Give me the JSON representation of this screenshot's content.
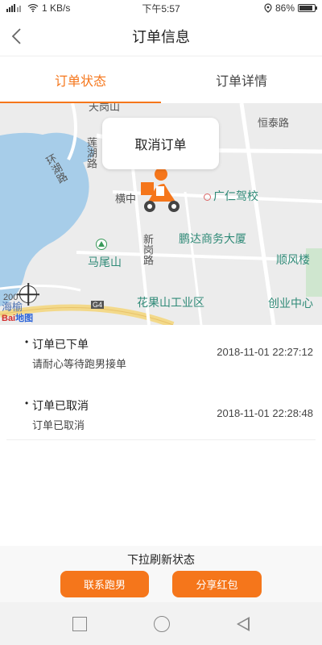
{
  "status_bar": {
    "network_speed": "1 KB/s",
    "time": "下午5:57",
    "battery": "86%",
    "icons": [
      "signal-icon",
      "wifi-icon",
      "location-icon",
      "battery-icon"
    ]
  },
  "header": {
    "title": "订单信息",
    "back_icon": "chevron-left-icon"
  },
  "tabs": [
    {
      "label": "订单状态",
      "active": true
    },
    {
      "label": "订单详情",
      "active": false
    }
  ],
  "map": {
    "cancel_button": "取消订单",
    "labels": {
      "tianmen": "天岗山",
      "hengtai": "恒泰路",
      "lianhu": "莲湖路",
      "huanhu": "环湖路",
      "guangren": "广仁驾校",
      "hengzhong": "横中",
      "pengda": "鹏达商务大厦",
      "xingang": "新岗路",
      "maweishan": "马尾山",
      "shunfeng": "顺风楼",
      "huaguoshan": "花果山工业区",
      "chuangye": "创业中心",
      "scale": "200",
      "haiyu": "海榆",
      "g4": "G4",
      "baidu": "Bai",
      "baidu2": "地图"
    },
    "icons": [
      "rider-icon",
      "locate-icon",
      "poi-icon",
      "mountain-icon"
    ]
  },
  "events": [
    {
      "title": "订单已下单",
      "desc": "请耐心等待跑男接单",
      "time": "2018-11-01 22:27:12"
    },
    {
      "title": "订单已取消",
      "desc": "订单已取消",
      "time": "2018-11-01 22:28:48"
    }
  ],
  "footer": {
    "hint": "下拉刷新状态",
    "contact_button": "联系跑男",
    "share_button": "分享红包"
  },
  "colors": {
    "accent": "#f5761b",
    "map_water": "#a7cde9",
    "map_green": "#2f8a77"
  }
}
